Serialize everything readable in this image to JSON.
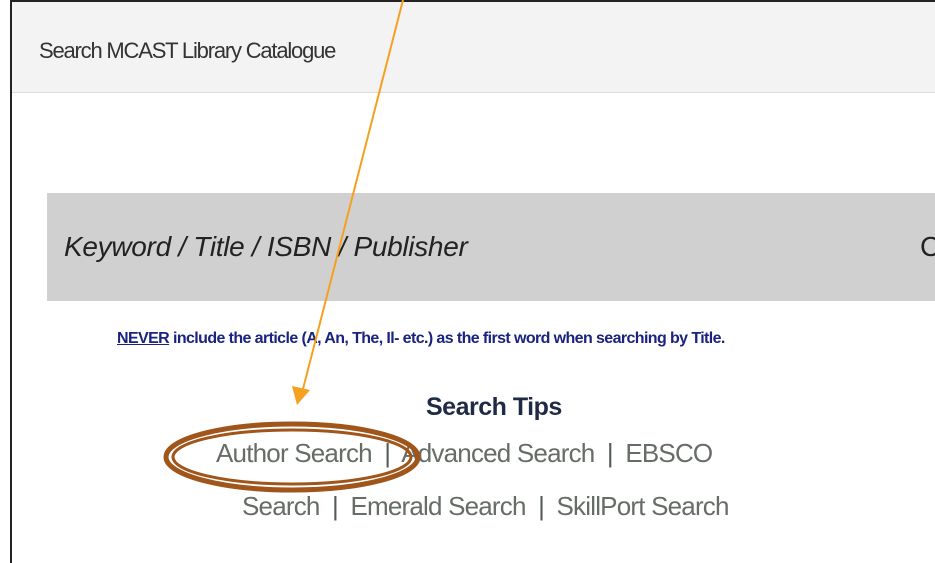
{
  "window": {
    "title": "Search MCAST Library Catalogue"
  },
  "search": {
    "label": "Keyword / Title / ISBN / Publisher",
    "cut_label": "C"
  },
  "notice": {
    "emphasis": "NEVER",
    "text": " include the article (A, An, The, Il- etc.) as the first word when searching by Title."
  },
  "tips": {
    "heading": "Search Tips",
    "links": {
      "author": "Author Search",
      "advanced": "Advanced Search",
      "ebsco_line1": "EBSCO",
      "ebsco_line2": "Search",
      "emerald": "Emerald Search",
      "skillport": "SkillPort Search"
    },
    "separator": "|"
  },
  "annotation": {
    "arrow_color": "#f5a020",
    "ellipse_color": "#a0561a"
  }
}
